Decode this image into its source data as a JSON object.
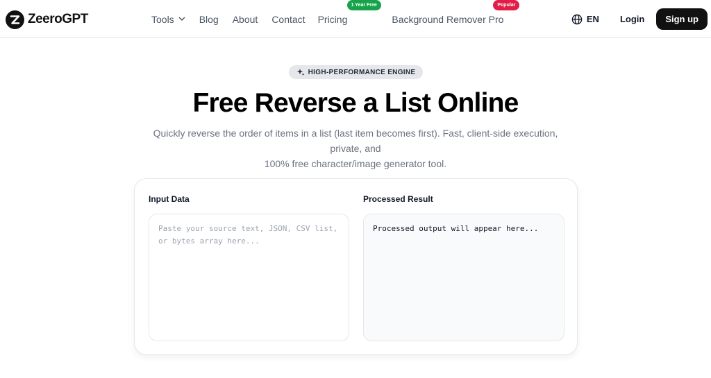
{
  "brand": {
    "name": "ZeeroGPT"
  },
  "nav": {
    "links": [
      {
        "label": "Tools",
        "dropdown": true
      },
      {
        "label": "Blog"
      },
      {
        "label": "About"
      },
      {
        "label": "Contact"
      },
      {
        "label": "Pricing",
        "badge": "1 Year Free"
      },
      {
        "label": "Background Remover Pro",
        "badge": "Popular"
      }
    ],
    "language": "EN",
    "login": "Login",
    "signup": "Sign up"
  },
  "hero": {
    "pill": "HIGH-PERFORMANCE ENGINE",
    "title": "Free Reverse a List Online",
    "subtitle_line1": "Quickly reverse the order of items in a list (last item becomes first). Fast, client-side execution, private, and",
    "subtitle_line2": "100% free character/image generator tool."
  },
  "tool": {
    "input_label": "Input Data",
    "input_placeholder": "Paste your source text, JSON, CSV list, or bytes array here...",
    "output_label": "Processed Result",
    "output_text": "Processed output will appear here..."
  },
  "icons": {
    "logo": "zeero-logo-icon",
    "tools_chevron": "chevron-down-icon",
    "language": "globe-icon",
    "engine": "sparkles-icon"
  },
  "colors": {
    "pricing_badge": "#16a34a",
    "popular_badge": "#e11d48",
    "primary_button": "#111111"
  }
}
